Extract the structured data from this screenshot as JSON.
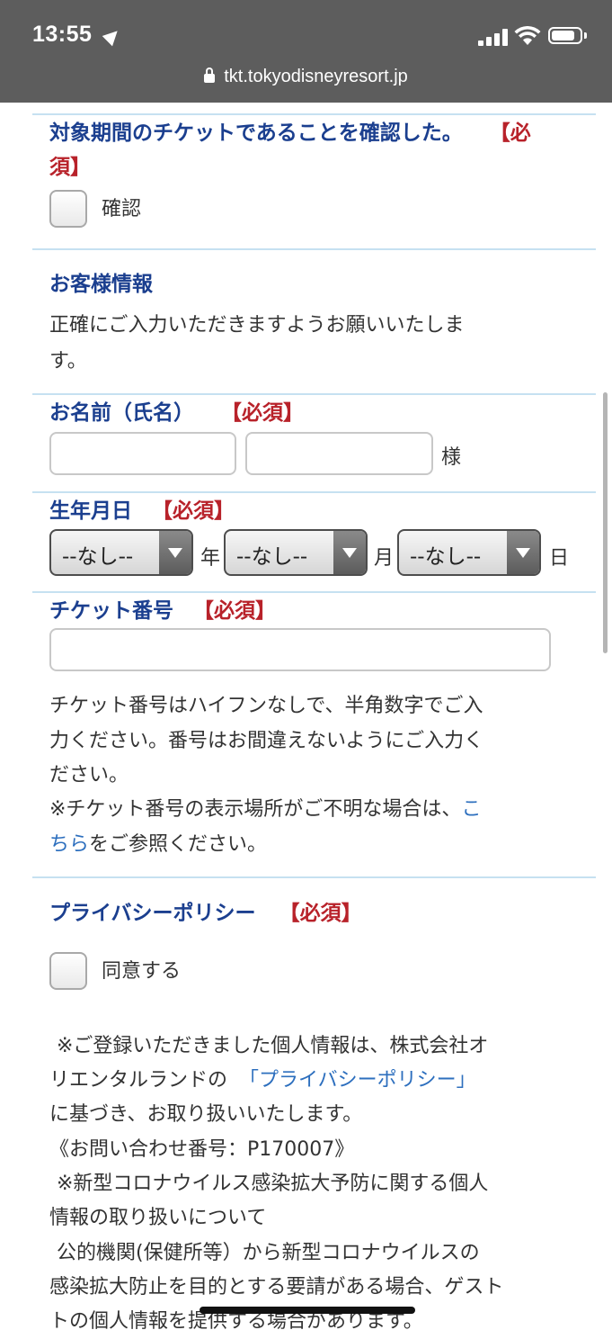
{
  "status_bar": {
    "time": "13:55"
  },
  "url_bar": {
    "domain": "tkt.tokyodisneyresort.jp"
  },
  "confirm_section": {
    "heading_line1": "対象期間のチケットであることを確認した。",
    "required_part1": "【必",
    "required_part2": "須】",
    "checkbox_label": "確認"
  },
  "customer_info": {
    "heading": "お客様情報",
    "description_line1": "正確にご入力いただきますようお願いいたしま",
    "description_line2": "す。"
  },
  "name_field": {
    "label": "お名前（氏名）",
    "required": "【必須】",
    "suffix": "様"
  },
  "birthdate": {
    "label": "生年月日",
    "required": "【必須】",
    "year_value": "--なし--",
    "month_value": "--なし--",
    "day_value": "--なし--",
    "year_unit": "年",
    "month_unit": "月",
    "day_unit": "日"
  },
  "ticket_number": {
    "label": "チケット番号",
    "required": "【必須】",
    "note_line1": "チケット番号はハイフンなしで、半角数字でご入",
    "note_line2": "力ください。番号はお間違えないようにご入力く",
    "note_line3": "ださい。",
    "note_line4": "※チケット番号の表示場所がご不明な場合は、",
    "link_part1": "こ",
    "link_part2": "ちら",
    "note_line5_rest": "をご参照ください。"
  },
  "privacy": {
    "heading": "プライバシーポリシー",
    "required": "【必須】",
    "checkbox_label": "同意する",
    "line1": "※ご登録いただきました個人情報は、株式会社オ",
    "line2_prefix": "リエンタルランドの",
    "policy_link": "「プライバシーポリシー」",
    "line3": "に基づき、お取り扱いいたします。",
    "line4": "《お問い合わせ番号：P170007》",
    "line5": "※新型コロナウイルス感染拡大予防に関する個人",
    "line6": "情報の取り扱いについて",
    "line7": "公的機関(保健所等）から新型コロナウイルスの",
    "line8": "感染拡大防止を目的とする要請がある場合、ゲスト",
    "line9": "トの個人情報を提供する場合があります。"
  }
}
